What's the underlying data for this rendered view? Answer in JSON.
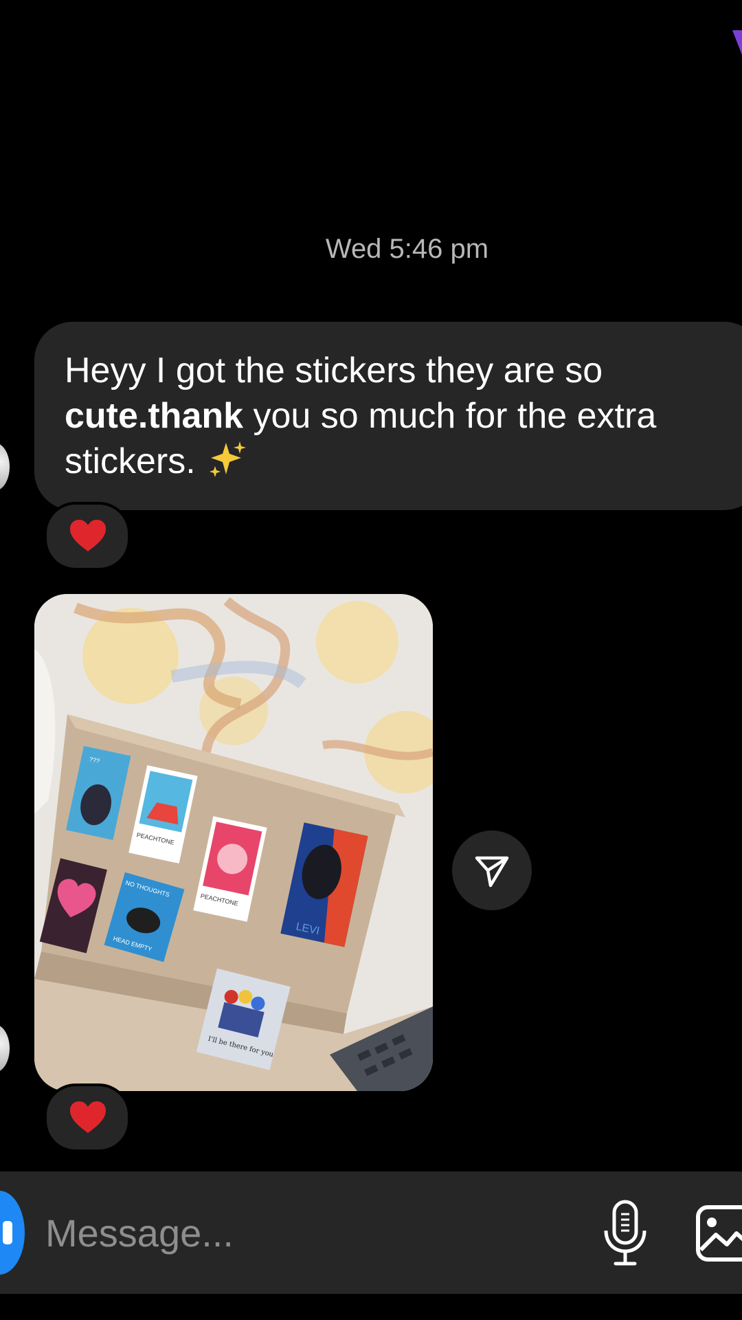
{
  "thread": {
    "timestamp": "Wed 5:46 pm"
  },
  "message": {
    "text_part1": "Heyy I got the stickers they are so",
    "text_bold": "cute.thank",
    "text_part2": " you so much for the extra stickers.",
    "emoji": "sparkles-icon",
    "reaction_emoji": "red-heart"
  },
  "photo": {
    "stickers": [
      {
        "label": "???"
      },
      {
        "label": "PEACHTONE"
      },
      {
        "label": "PEACHTONE"
      },
      {
        "label": "LEVI"
      },
      {
        "label": "NO THOUGHTS"
      },
      {
        "label": "HEAD EMPTY"
      },
      {
        "label": "I'll be there for you"
      }
    ],
    "reaction_emoji": "red-heart"
  },
  "composer": {
    "placeholder": "Message...",
    "icons": [
      "camera-icon",
      "microphone-icon",
      "gallery-icon"
    ]
  },
  "colors": {
    "background": "#000000",
    "bubble": "#262626",
    "timestamp": "#b8b8b8",
    "heart": "#e0262d",
    "camera_button": "#1e88f5",
    "accent": "#7b3fd9"
  }
}
